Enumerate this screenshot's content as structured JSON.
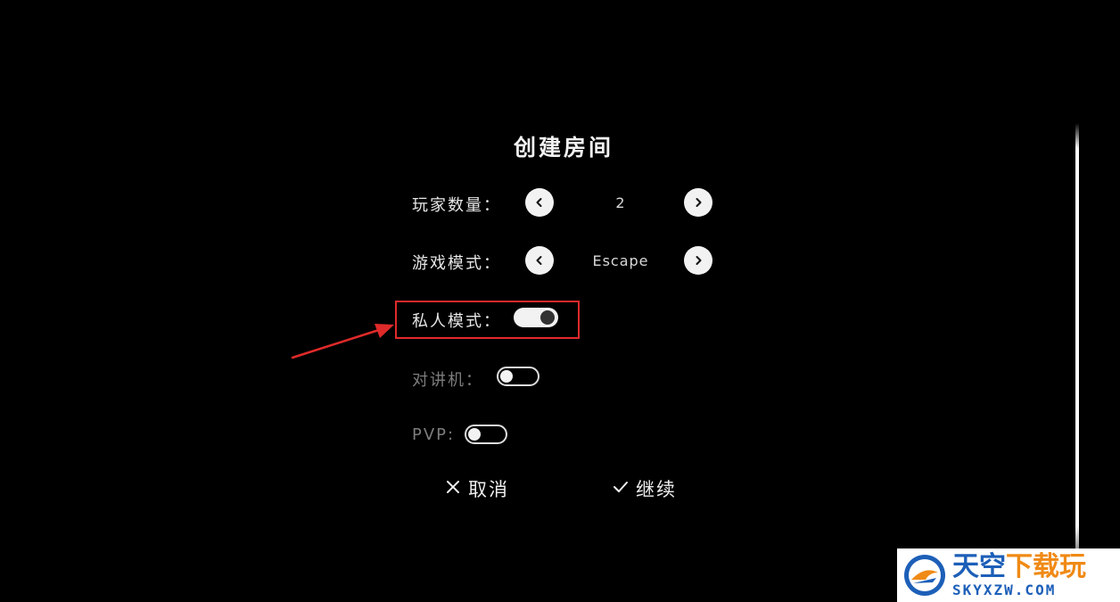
{
  "dialog": {
    "title": "创建房间",
    "player_count": {
      "label": "玩家数量：",
      "value": "2",
      "prev_icon": "chevron-left-icon",
      "next_icon": "chevron-right-icon"
    },
    "game_mode": {
      "label": "游戏模式：",
      "value": "Escape",
      "prev_icon": "chevron-left-icon",
      "next_icon": "chevron-right-icon"
    },
    "private_mode": {
      "label": "私人模式：",
      "enabled": true
    },
    "walkie_talkie": {
      "label": "对讲机：",
      "enabled": false
    },
    "pvp": {
      "label": "PVP:",
      "enabled": false
    },
    "cancel": {
      "icon": "close-icon",
      "label": "取消"
    },
    "continue": {
      "icon": "check-icon",
      "label": "继续"
    }
  },
  "annotation": {
    "highlight_color": "#e02a2a"
  },
  "watermark": {
    "brand_part1": "天空",
    "brand_part2": "下载玩",
    "site": "SKYXZW.COM",
    "primary_color": "#1d5fb8",
    "accent_color": "#f08a16"
  },
  "colors": {
    "background": "#000000",
    "text": "#e6e6e6",
    "disabled_text": "#7d7d7d"
  }
}
